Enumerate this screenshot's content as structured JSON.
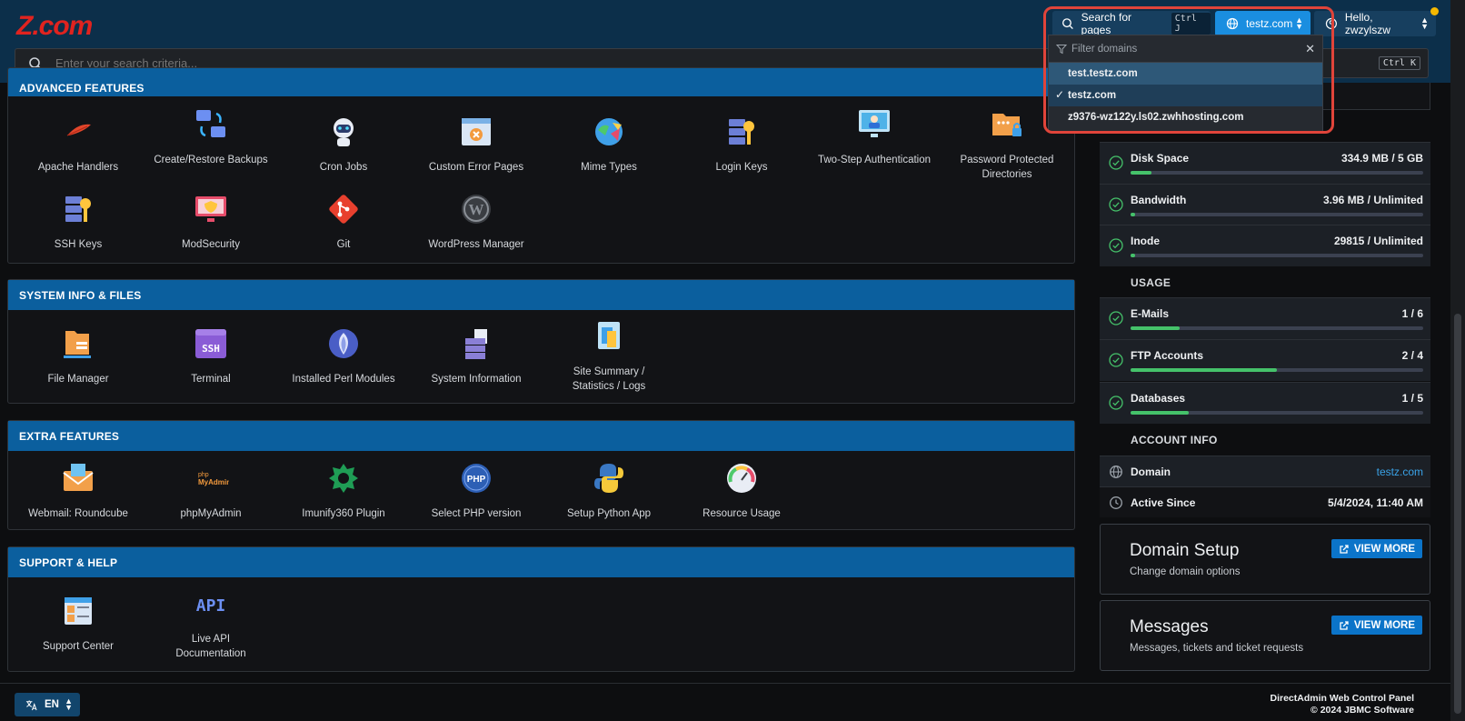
{
  "brand": {
    "logo_text": "Z.com"
  },
  "header": {
    "search_pages_label": "Search for pages",
    "search_pages_shortcut": "Ctrl J",
    "domain_selected": "testz.com",
    "user_greeting": "Hello, zwzylszw"
  },
  "searchbar": {
    "placeholder": "Enter your search criteria...",
    "shortcut": "Ctrl K"
  },
  "domain_dropdown": {
    "filter_placeholder": "Filter domains",
    "options": [
      "test.testz.com",
      "testz.com",
      "z9376-wz122y.ls02.zwhhosting.com"
    ]
  },
  "sections": {
    "advanced": {
      "title": "ADVANCED FEATURES",
      "items": [
        "Apache Handlers",
        "Create/Restore Backups",
        "Cron Jobs",
        "Custom Error Pages",
        "Mime Types",
        "Login Keys",
        "Two-Step Authentication",
        "Password Protected Directories",
        "SSH Keys",
        "ModSecurity",
        "Git",
        "WordPress Manager"
      ]
    },
    "system": {
      "title": "SYSTEM INFO & FILES",
      "items": [
        "File Manager",
        "Terminal",
        "Installed Perl Modules",
        "System Information",
        "Site Summary / Statistics / Logs"
      ]
    },
    "extra": {
      "title": "EXTRA FEATURES",
      "items": [
        "Webmail: Roundcube",
        "phpMyAdmin",
        "Imunify360 Plugin",
        "Select PHP version",
        "Setup Python App",
        "Resource Usage"
      ]
    },
    "support": {
      "title": "SUPPORT & HELP",
      "items": [
        "Support Center",
        "Live API Documentation"
      ]
    }
  },
  "sidebar": {
    "stats": [
      {
        "label": "Disk Space",
        "value": "334.9 MB / 5 GB",
        "progress": 0.07
      },
      {
        "label": "Bandwidth",
        "value": "3.96 MB / Unlimited",
        "progress": 0.01
      },
      {
        "label": "Inode",
        "value": "29815 / Unlimited",
        "progress": 0.01
      }
    ],
    "usage_label": "USAGE",
    "usage": [
      {
        "label": "E-Mails",
        "value": "1 / 6",
        "progress": 0.167
      },
      {
        "label": "FTP Accounts",
        "value": "2 / 4",
        "progress": 0.5
      },
      {
        "label": "Databases",
        "value": "1 / 5",
        "progress": 0.2
      }
    ],
    "account_label": "ACCOUNT INFO",
    "account": [
      {
        "label": "Domain",
        "value": "testz.com"
      },
      {
        "label": "Active Since",
        "value": "5/4/2024, 11:40 AM"
      }
    ],
    "cards": [
      {
        "title": "Domain Setup",
        "subtitle": "Change domain options",
        "button": "VIEW MORE"
      },
      {
        "title": "Messages",
        "subtitle": "Messages, tickets and ticket requests",
        "button": "VIEW MORE"
      }
    ]
  },
  "footer": {
    "language": "EN",
    "product": "DirectAdmin Web Control Panel",
    "copyright": "© 2024 JBMC Software"
  },
  "colors": {
    "accent": "#0b5f9e",
    "brand_red": "#e0231f",
    "progress_green": "#45c26a",
    "highlight_box": "#e0443a"
  }
}
